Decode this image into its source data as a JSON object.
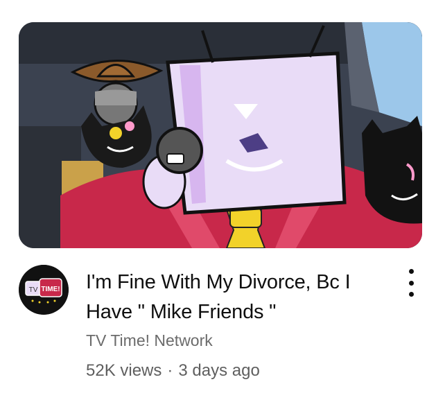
{
  "video": {
    "title": "I'm Fine With My Divorce, Bc I Have \" Mike  Friends \"",
    "channel": "TV Time! Network",
    "views": "52K views",
    "separator": "·",
    "age": "3 days ago"
  },
  "avatar": {
    "logo_text_left": "TV",
    "logo_text_right": "TIME!"
  },
  "icons": {
    "more": "more-vert-icon"
  },
  "colors": {
    "title": "#0f0f0f",
    "secondary": "#606060",
    "suit": "#c8284a",
    "tie": "#f2d22a",
    "tv_head": "#e9dcf7"
  }
}
